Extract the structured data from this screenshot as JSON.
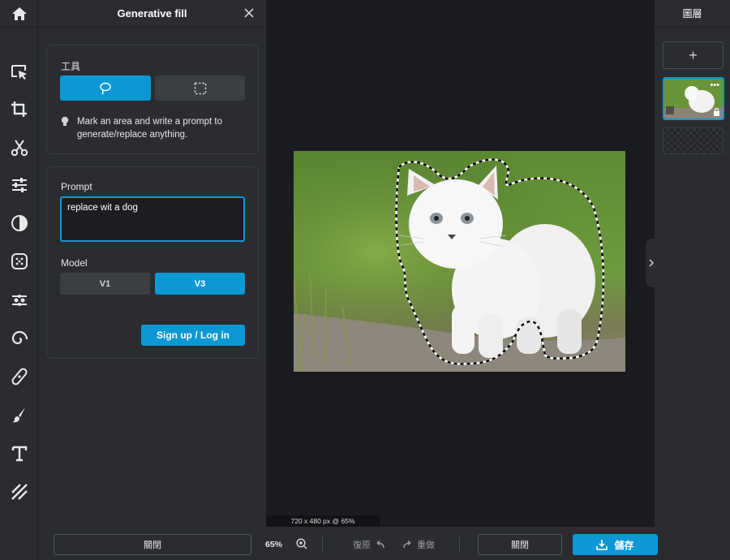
{
  "panel": {
    "title": "Generative fill",
    "tools_label": "工具",
    "hint": "Mark an area and write a prompt to generate/replace anything.",
    "prompt_label": "Prompt",
    "prompt_value": "replace wit a dog",
    "model_label": "Model",
    "model_options": [
      "V1",
      "V3"
    ],
    "model_selected": "V3",
    "signup_label": "Sign up / Log in",
    "close_label": "關閉"
  },
  "canvas": {
    "size_readout": "720 x 480 px @ 65%"
  },
  "layers": {
    "title": "圖層",
    "add_label": "+"
  },
  "bottombar": {
    "zoom": "65%",
    "undo": "復原",
    "redo": "重做",
    "close": "關閉",
    "save": "儲存"
  },
  "colors": {
    "accent": "#0c98d4",
    "panel_bg": "#2a2c30",
    "canvas_bg": "#1a1b1e"
  }
}
